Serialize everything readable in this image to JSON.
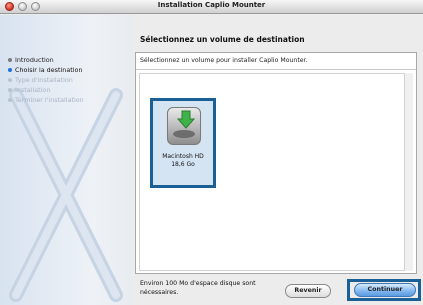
{
  "window": {
    "title": "Installation Caplio Mounter"
  },
  "sidebar": {
    "steps": [
      {
        "label": "Introduction",
        "state": "done"
      },
      {
        "label": "Choisir la destination",
        "state": "current"
      },
      {
        "label": "Type d'installation",
        "state": "pending"
      },
      {
        "label": "Installation",
        "state": "pending"
      },
      {
        "label": "Terminer l'installation",
        "state": "pending"
      }
    ]
  },
  "main": {
    "heading": "Sélectionnez un volume de destination",
    "instruction": "Sélectionnez un volume pour installer Caplio Mounter.",
    "volume": {
      "name": "Macintosh HD",
      "size": "18,6 Go",
      "icon": "hard-disk-install-icon",
      "selected": true
    },
    "space_note": "Environ 100 Mo d'espace disque sont nécessaires."
  },
  "buttons": {
    "back": "Revenir",
    "continue": "Continuer"
  },
  "colors": {
    "highlight_frame": "#1a5f96",
    "current_step_dot": "#1e6fd9",
    "default_button": "#7fb6ee"
  }
}
